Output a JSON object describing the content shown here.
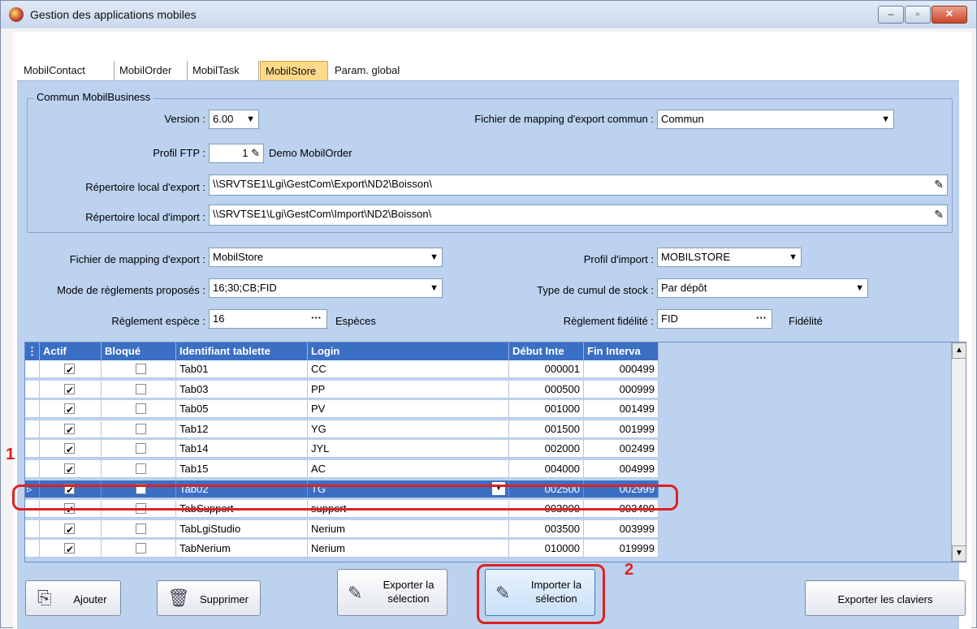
{
  "window": {
    "title": "Gestion des applications mobiles"
  },
  "tabs": [
    "MobilContact",
    "MobilOrder",
    "MobilTask",
    "MobilStore",
    "Param. global"
  ],
  "common": {
    "group_title": "Commun MobilBusiness",
    "version_label": "Version :",
    "version_value": "6.00",
    "mapping_common_label": "Fichier de mapping d'export commun :",
    "mapping_common_value": "Commun",
    "ftp_label": "Profil FTP :",
    "ftp_value": "1",
    "ftp_name": "Demo MobilOrder",
    "export_dir_label": "Répertoire local d'export :",
    "export_dir_value": "\\\\SRVTSE1\\Lgi\\GestCom\\Export\\ND2\\Boisson\\",
    "import_dir_label": "Répertoire local d'import :",
    "import_dir_value": "\\\\SRVTSE1\\Lgi\\GestCom\\Import\\ND2\\Boisson\\"
  },
  "settings": {
    "mapping_label": "Fichier de mapping d'export :",
    "mapping_value": "MobilStore",
    "import_profile_label": "Profil d'import :",
    "import_profile_value": "MOBILSTORE",
    "payment_modes_label": "Mode de règlements proposés :",
    "payment_modes_value": "16;30;CB;FID",
    "stock_label": "Type de cumul de stock :",
    "stock_value": "Par dépôt",
    "cash_label": "Règlement espèce :",
    "cash_value": "16",
    "cash_name": "Espèces",
    "loyalty_label": "Règlement fidélité :",
    "loyalty_value": "FID",
    "loyalty_name": "Fidélité"
  },
  "grid": {
    "columns": [
      "Actif",
      "Bloqué",
      "Identifiant tablette",
      "Login",
      "Début Inte",
      "Fin Interva"
    ],
    "rows": [
      {
        "actif": true,
        "bloque": false,
        "id": "Tab01",
        "login": "CC",
        "debut": "000001",
        "fin": "000499"
      },
      {
        "actif": true,
        "bloque": false,
        "id": "Tab03",
        "login": "PP",
        "debut": "000500",
        "fin": "000999"
      },
      {
        "actif": true,
        "bloque": false,
        "id": "Tab05",
        "login": "PV",
        "debut": "001000",
        "fin": "001499"
      },
      {
        "actif": true,
        "bloque": false,
        "id": "Tab12",
        "login": "YG",
        "debut": "001500",
        "fin": "001999"
      },
      {
        "actif": true,
        "bloque": false,
        "id": "Tab14",
        "login": "JYL",
        "debut": "002000",
        "fin": "002499"
      },
      {
        "actif": true,
        "bloque": false,
        "id": "Tab15",
        "login": "AC",
        "debut": "004000",
        "fin": "004999"
      },
      {
        "actif": true,
        "bloque": false,
        "id": "Tab02",
        "login": "TG",
        "debut": "002500",
        "fin": "002999",
        "selected": true
      },
      {
        "actif": true,
        "bloque": false,
        "id": "TabSupport",
        "login": "support",
        "debut": "003000",
        "fin": "003499"
      },
      {
        "actif": true,
        "bloque": false,
        "id": "TabLgiStudio",
        "login": "Nerium",
        "debut": "003500",
        "fin": "003999"
      },
      {
        "actif": true,
        "bloque": false,
        "id": "TabNerium",
        "login": "Nerium",
        "debut": "010000",
        "fin": "019999"
      }
    ]
  },
  "buttons": {
    "add": "Ajouter",
    "delete": "Supprimer",
    "export_sel_1": "Exporter la",
    "export_sel_2": "sélection",
    "import_sel_1": "Importer la",
    "import_sel_2": "sélection",
    "export_keyboards": "Exporter les claviers"
  },
  "annotations": {
    "marker1": "1",
    "marker2": "2",
    "color": "#e02020"
  }
}
